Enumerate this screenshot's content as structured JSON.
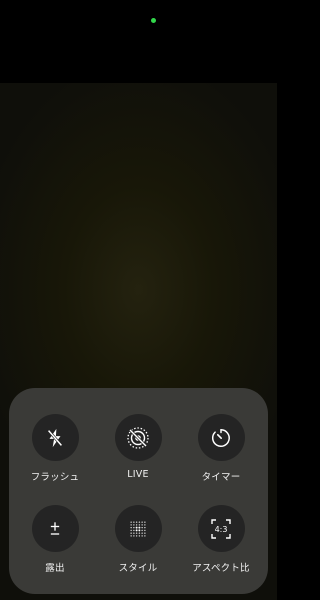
{
  "status": {
    "camera_indicator_color": "#32d74b"
  },
  "controls": [
    {
      "label": "フラッシュ",
      "icon": "flash-off-icon"
    },
    {
      "label": "LIVE",
      "icon": "live-photo-off-icon"
    },
    {
      "label": "タイマー",
      "icon": "timer-icon"
    },
    {
      "label": "露出",
      "icon": "exposure-plus-minus-icon"
    },
    {
      "label": "スタイル",
      "icon": "photographic-styles-grid-icon"
    },
    {
      "label": "アスペクト比",
      "icon": "aspect-ratio-4-3-icon"
    }
  ],
  "aspect_icon_text": "4:3"
}
